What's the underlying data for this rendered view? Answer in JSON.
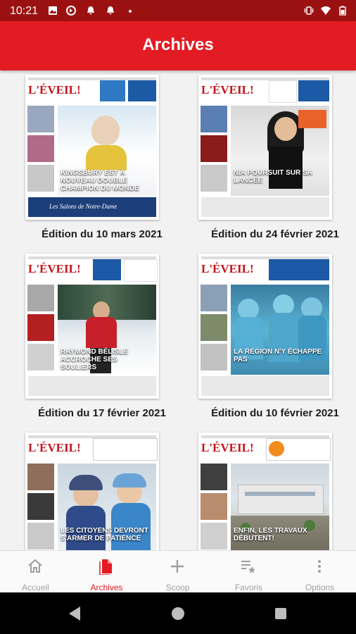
{
  "status_bar": {
    "time": "10:21",
    "left_icons": [
      "image-icon",
      "sync-icon",
      "notification-icon",
      "notification-icon",
      "dot-icon"
    ],
    "right_icons": [
      "vibrate-icon",
      "wifi-icon",
      "battery-icon"
    ]
  },
  "app_bar": {
    "title": "Archives"
  },
  "colors": {
    "brand_red": "#e31b23",
    "status_red": "#9b1111",
    "nav_inactive": "#9e9e9e"
  },
  "editions": [
    {
      "caption": "Édition du 10 mars 2021",
      "cover_brand": "L'ÉVEIL!",
      "cover_headline": "KINGSBURY EST À NOUVEAU DOUBLE CHAMPION DU MONDE",
      "photo_theme": "ski",
      "bottom_text": "Les Salons de Notre-Dame"
    },
    {
      "caption": "Édition du 24 février 2021",
      "cover_brand": "L'ÉVEIL!",
      "cover_headline": "NIA POURSUIT SUR SA LANCÉE",
      "photo_theme": "portrait",
      "bottom_text": ""
    },
    {
      "caption": "Édition du 17 février 2021",
      "cover_brand": "L'ÉVEIL!",
      "cover_headline": "RAYMOND BÉLISLE ACCROCHE SES SOULIERS",
      "photo_theme": "winter",
      "bottom_text": ""
    },
    {
      "caption": "Édition du 10 février 2021",
      "cover_brand": "L'ÉVEIL!",
      "cover_headline": "LA RÉGION N'Y ÉCHAPPE PAS",
      "photo_theme": "hospital",
      "bottom_text": ""
    },
    {
      "caption": "",
      "cover_brand": "L'ÉVEIL!",
      "cover_headline": "LES CITOYENS DEVRONT S'ARMER DE PATIENCE",
      "photo_theme": "kids",
      "bottom_text": ""
    },
    {
      "caption": "",
      "cover_brand": "L'ÉVEIL!",
      "cover_headline": "ENFIN, LES TRAVAUX DÉBUTENT!",
      "photo_theme": "building",
      "bottom_text": ""
    }
  ],
  "bottom_nav": [
    {
      "label": "Accueil",
      "icon": "home-icon",
      "active": false
    },
    {
      "label": "Archives",
      "icon": "document-icon",
      "active": true
    },
    {
      "label": "Scoop",
      "icon": "plus-icon",
      "active": false
    },
    {
      "label": "Favoris",
      "icon": "star-list-icon",
      "active": false
    },
    {
      "label": "Options",
      "icon": "more-vert-icon",
      "active": false
    }
  ],
  "system_nav": [
    "back-icon",
    "home-circle-icon",
    "recents-icon"
  ]
}
